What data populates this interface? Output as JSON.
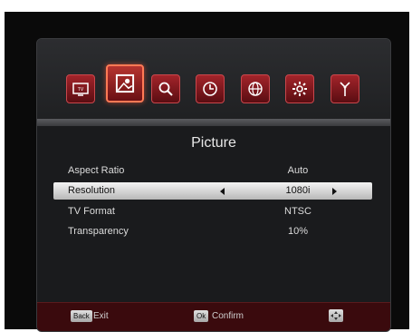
{
  "menu_icons": [
    {
      "name": "tv-icon",
      "selected": false
    },
    {
      "name": "picture-icon",
      "selected": true
    },
    {
      "name": "search-icon",
      "selected": false
    },
    {
      "name": "clock-icon",
      "selected": false
    },
    {
      "name": "globe-icon",
      "selected": false
    },
    {
      "name": "gear-icon",
      "selected": false
    },
    {
      "name": "antenna-icon",
      "selected": false
    }
  ],
  "page_title": "Picture",
  "settings": [
    {
      "label": "Aspect Ratio",
      "value": "Auto"
    },
    {
      "label": "Resolution",
      "value": "1080i",
      "selected": true
    },
    {
      "label": "TV Format",
      "value": "NTSC"
    },
    {
      "label": "Transparency",
      "value": "10%"
    }
  ],
  "footer": {
    "back_key": "Back",
    "back_label": "Exit",
    "ok_key": "Ok",
    "ok_label": "Confirm",
    "nav_icon": "navigate-icon"
  },
  "colors": {
    "accent_red": "#a3242a",
    "selected_row": "#e0e0e0",
    "footer_bg": "#3a0a0d"
  }
}
